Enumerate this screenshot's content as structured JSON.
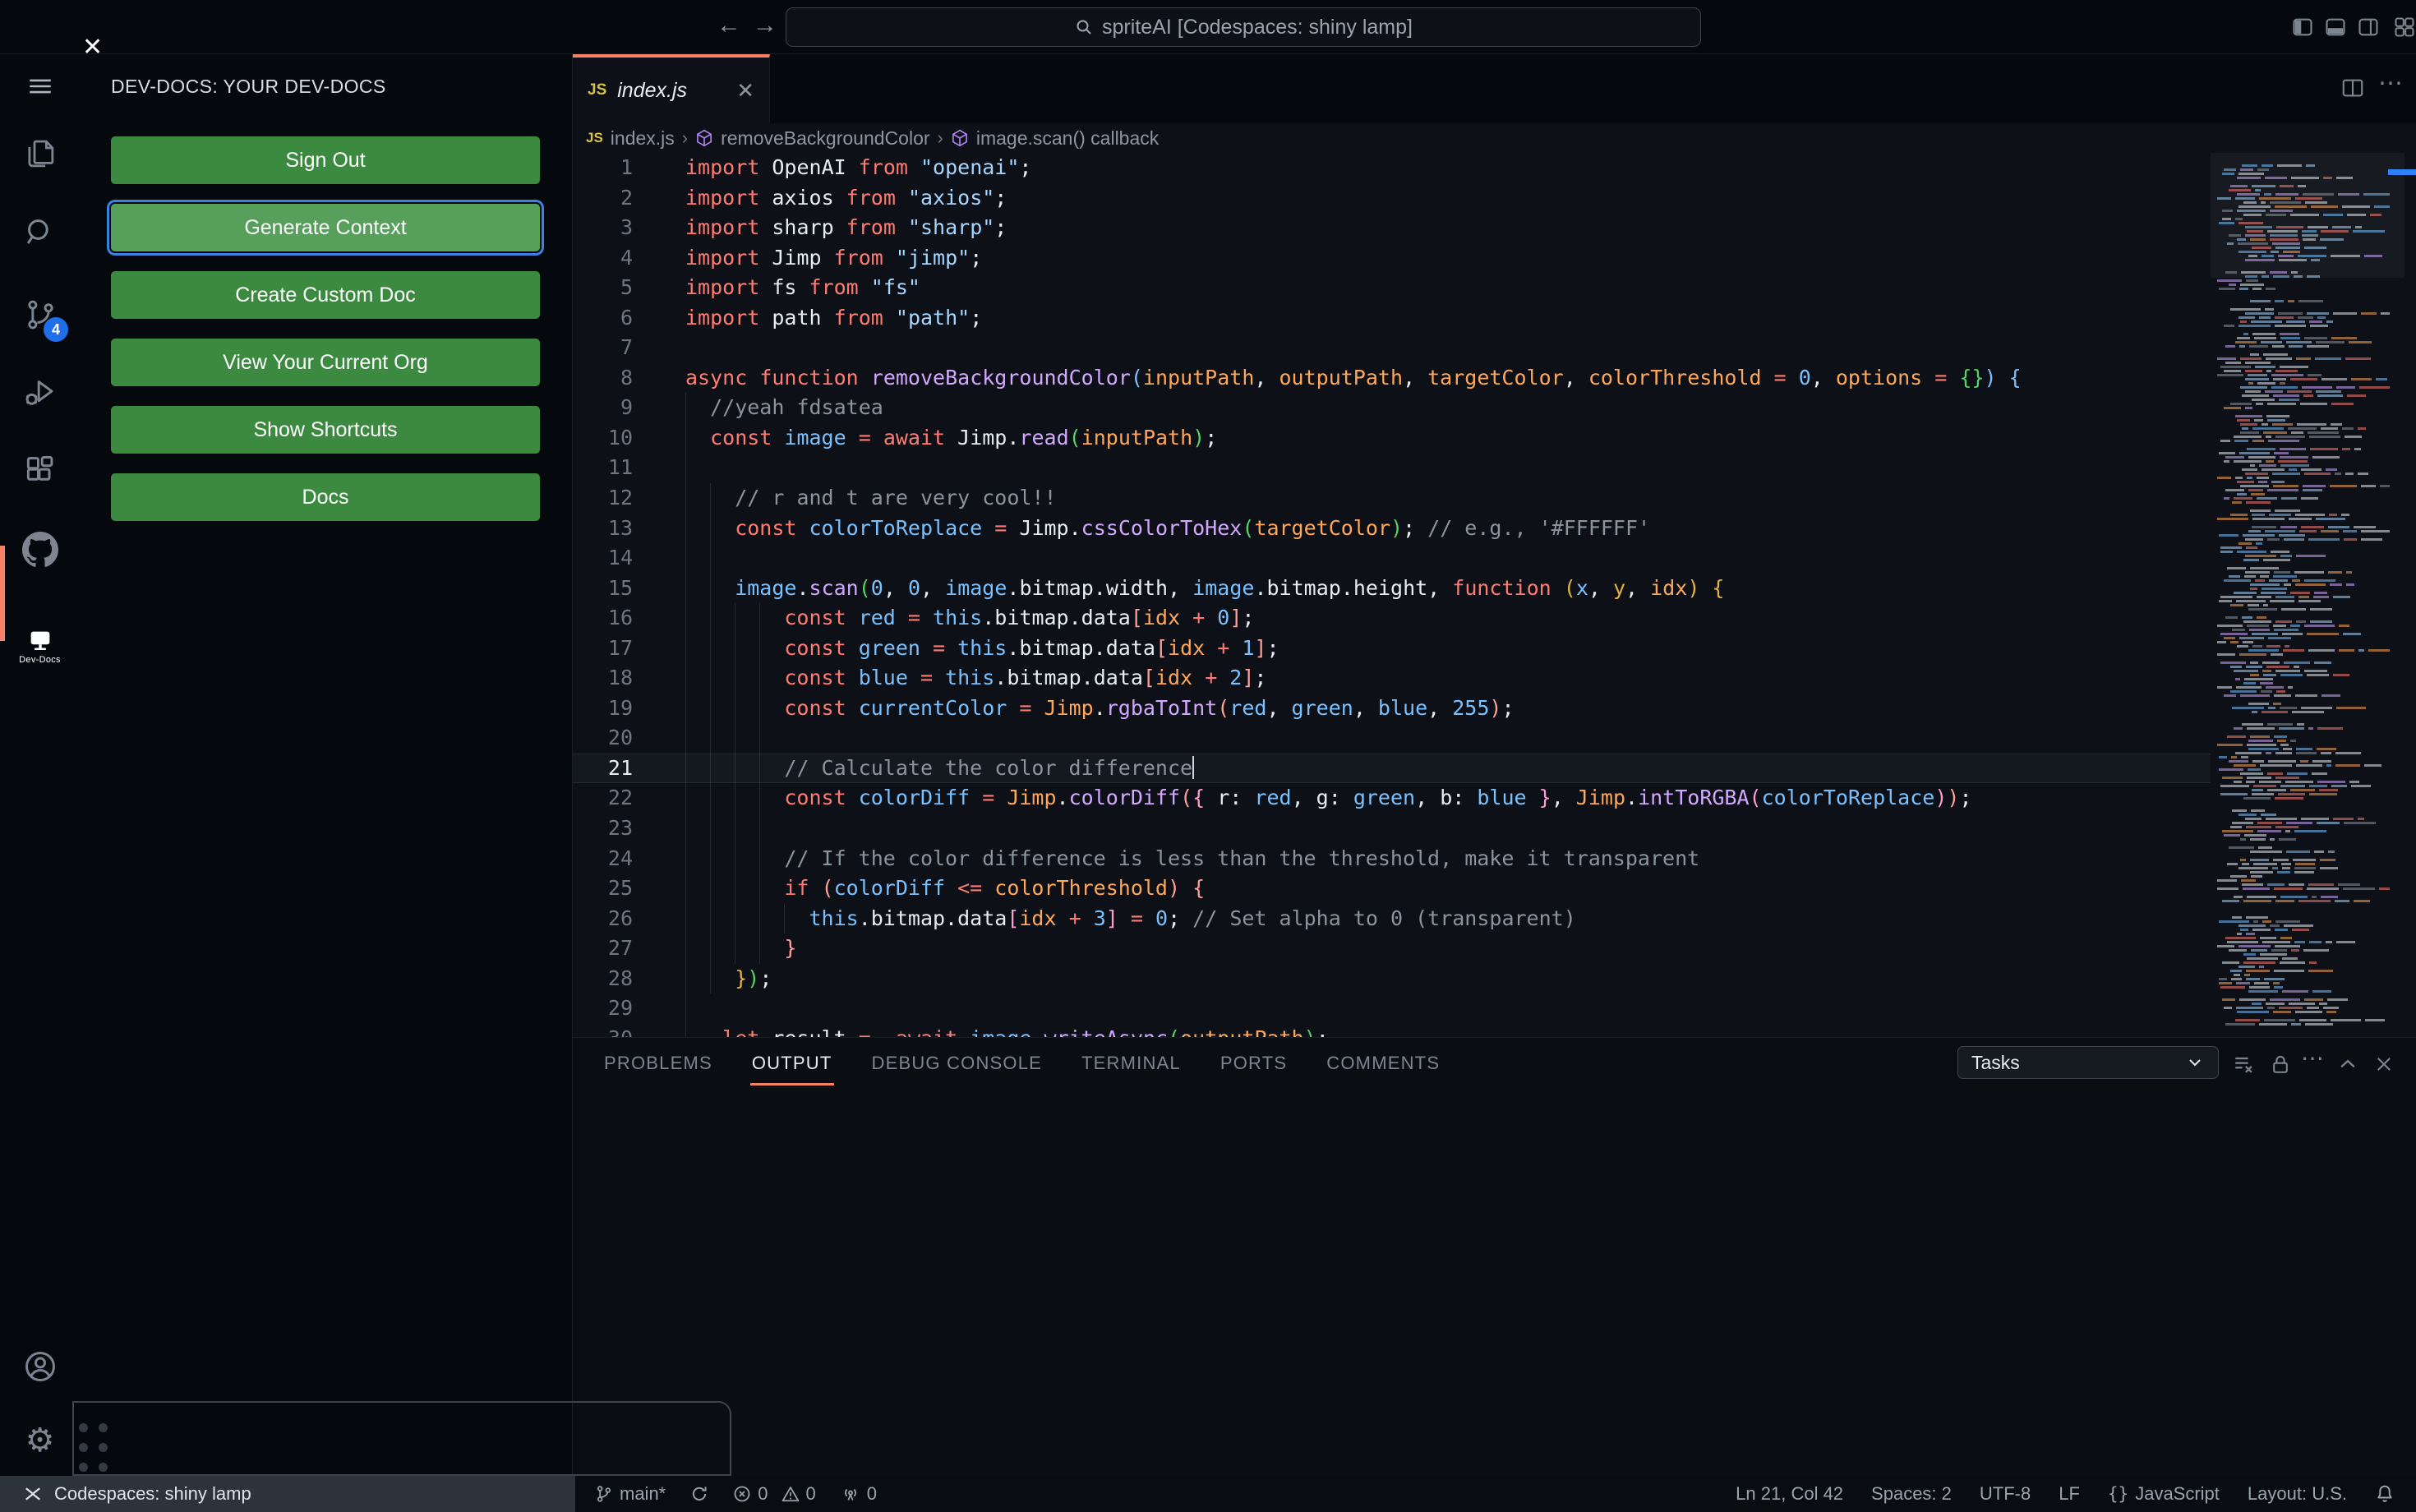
{
  "title_bar": {
    "search_text": "spriteAI [Codespaces: shiny lamp]"
  },
  "activity_bar": {
    "scm_badge": "4",
    "devdocs_label": "Dev-Docs"
  },
  "sidebar": {
    "header": "DEV-DOCS: YOUR DEV-DOCS",
    "buttons": [
      {
        "label": "Sign Out",
        "focused": false
      },
      {
        "label": "Generate Context",
        "focused": true
      },
      {
        "label": "Create Custom Doc",
        "focused": false
      },
      {
        "label": "View Your Current Org",
        "focused": false
      },
      {
        "label": "Show Shortcuts",
        "focused": false
      },
      {
        "label": "Docs",
        "focused": false
      }
    ]
  },
  "editor": {
    "tab": {
      "badge": "JS",
      "name": "index.js",
      "close": "✕"
    },
    "breadcrumb": [
      {
        "label": "index.js"
      },
      {
        "label": "removeBackgroundColor"
      },
      {
        "label": "image.scan() callback"
      }
    ],
    "cursor": {
      "line": 21,
      "col": 42
    },
    "lines": [
      {
        "n": 1,
        "ind": 0,
        "g": 0,
        "t": [
          [
            "import ",
            "k"
          ],
          [
            "OpenAI ",
            "w"
          ],
          [
            "from ",
            "k"
          ],
          [
            "\"openai\"",
            "s"
          ],
          [
            ";",
            "w"
          ]
        ]
      },
      {
        "n": 2,
        "ind": 0,
        "g": 0,
        "t": [
          [
            "import ",
            "k"
          ],
          [
            "axios ",
            "w"
          ],
          [
            "from ",
            "k"
          ],
          [
            "\"axios\"",
            "s"
          ],
          [
            ";",
            "w"
          ]
        ]
      },
      {
        "n": 3,
        "ind": 0,
        "g": 0,
        "t": [
          [
            "import ",
            "k"
          ],
          [
            "sharp ",
            "w"
          ],
          [
            "from ",
            "k"
          ],
          [
            "\"sharp\"",
            "s"
          ],
          [
            ";",
            "w"
          ]
        ]
      },
      {
        "n": 4,
        "ind": 0,
        "g": 0,
        "t": [
          [
            "import ",
            "k"
          ],
          [
            "Jimp ",
            "w"
          ],
          [
            "from ",
            "k"
          ],
          [
            "\"jimp\"",
            "s"
          ],
          [
            ";",
            "w"
          ]
        ]
      },
      {
        "n": 5,
        "ind": 0,
        "g": 0,
        "t": [
          [
            "import ",
            "k"
          ],
          [
            "fs ",
            "w"
          ],
          [
            "from ",
            "k"
          ],
          [
            "\"fs\"",
            "s"
          ]
        ]
      },
      {
        "n": 6,
        "ind": 0,
        "g": 0,
        "t": [
          [
            "import ",
            "k"
          ],
          [
            "path ",
            "w"
          ],
          [
            "from ",
            "k"
          ],
          [
            "\"path\"",
            "s"
          ],
          [
            ";",
            "w"
          ]
        ]
      },
      {
        "n": 7,
        "ind": 0,
        "g": 0,
        "t": []
      },
      {
        "n": 8,
        "ind": 0,
        "g": 0,
        "t": [
          [
            "async ",
            "k"
          ],
          [
            "function ",
            "k"
          ],
          [
            "removeBackgroundColor",
            "f"
          ],
          [
            "(",
            "b1"
          ],
          [
            "inputPath",
            "p"
          ],
          [
            ", ",
            "w"
          ],
          [
            "outputPath",
            "p"
          ],
          [
            ", ",
            "w"
          ],
          [
            "targetColor",
            "p"
          ],
          [
            ", ",
            "w"
          ],
          [
            "colorThreshold ",
            "p"
          ],
          [
            "= ",
            "k"
          ],
          [
            "0",
            "v"
          ],
          [
            ", ",
            "w"
          ],
          [
            "options ",
            "p"
          ],
          [
            "= ",
            "k"
          ],
          [
            "{}",
            "b2"
          ],
          [
            ") ",
            "b1"
          ],
          [
            "{",
            "b1"
          ]
        ]
      },
      {
        "n": 9,
        "ind": 2,
        "g": 1,
        "t": [
          [
            "//yeah fdsatea",
            "c"
          ]
        ]
      },
      {
        "n": 10,
        "ind": 2,
        "g": 1,
        "t": [
          [
            "const ",
            "k"
          ],
          [
            "image ",
            "v"
          ],
          [
            "= ",
            "k"
          ],
          [
            "await ",
            "k"
          ],
          [
            "Jimp",
            "w"
          ],
          [
            ".",
            "w"
          ],
          [
            "read",
            "f"
          ],
          [
            "(",
            "b2"
          ],
          [
            "inputPath",
            "p"
          ],
          [
            ")",
            "b2"
          ],
          [
            ";",
            "w"
          ]
        ]
      },
      {
        "n": 11,
        "ind": 2,
        "g": 1,
        "t": []
      },
      {
        "n": 12,
        "ind": 4,
        "g": 2,
        "t": [
          [
            "// r and t are very cool!!",
            "c"
          ]
        ]
      },
      {
        "n": 13,
        "ind": 4,
        "g": 2,
        "t": [
          [
            "const ",
            "k"
          ],
          [
            "colorToReplace ",
            "v"
          ],
          [
            "= ",
            "k"
          ],
          [
            "Jimp",
            "w"
          ],
          [
            ".",
            "w"
          ],
          [
            "cssColorToHex",
            "f"
          ],
          [
            "(",
            "b2"
          ],
          [
            "targetColor",
            "p"
          ],
          [
            ")",
            "b2"
          ],
          [
            "; ",
            "w"
          ],
          [
            "// e.g., '#FFFFFF'",
            "c"
          ]
        ]
      },
      {
        "n": 14,
        "ind": 4,
        "g": 2,
        "t": []
      },
      {
        "n": 15,
        "ind": 4,
        "g": 2,
        "t": [
          [
            "image",
            "v"
          ],
          [
            ".",
            "w"
          ],
          [
            "scan",
            "f"
          ],
          [
            "(",
            "b2"
          ],
          [
            "0",
            "v"
          ],
          [
            ", ",
            "w"
          ],
          [
            "0",
            "v"
          ],
          [
            ", ",
            "w"
          ],
          [
            "image",
            "v"
          ],
          [
            ".bitmap.width",
            "w"
          ],
          [
            ", ",
            "w"
          ],
          [
            "image",
            "v"
          ],
          [
            ".bitmap.height",
            "w"
          ],
          [
            ", ",
            "w"
          ],
          [
            "function ",
            "k"
          ],
          [
            "(",
            "b3"
          ],
          [
            "x",
            "v"
          ],
          [
            ", ",
            "w"
          ],
          [
            "y",
            "y"
          ],
          [
            ", ",
            "w"
          ],
          [
            "idx",
            "p"
          ],
          [
            ") ",
            "b3"
          ],
          [
            "{",
            "b3"
          ]
        ]
      },
      {
        "n": 16,
        "ind": 8,
        "g": 4,
        "t": [
          [
            "const ",
            "k"
          ],
          [
            "red ",
            "v"
          ],
          [
            "= ",
            "k"
          ],
          [
            "this",
            "v"
          ],
          [
            ".bitmap.data",
            "w"
          ],
          [
            "[",
            "b4"
          ],
          [
            "idx ",
            "p"
          ],
          [
            "+ ",
            "k"
          ],
          [
            "0",
            "v"
          ],
          [
            "]",
            "b4"
          ],
          [
            ";",
            "w"
          ]
        ]
      },
      {
        "n": 17,
        "ind": 8,
        "g": 4,
        "t": [
          [
            "const ",
            "k"
          ],
          [
            "green ",
            "v"
          ],
          [
            "= ",
            "k"
          ],
          [
            "this",
            "v"
          ],
          [
            ".bitmap.data",
            "w"
          ],
          [
            "[",
            "b4"
          ],
          [
            "idx ",
            "p"
          ],
          [
            "+ ",
            "k"
          ],
          [
            "1",
            "v"
          ],
          [
            "]",
            "b4"
          ],
          [
            ";",
            "w"
          ]
        ]
      },
      {
        "n": 18,
        "ind": 8,
        "g": 4,
        "t": [
          [
            "const ",
            "k"
          ],
          [
            "blue ",
            "v"
          ],
          [
            "= ",
            "k"
          ],
          [
            "this",
            "v"
          ],
          [
            ".bitmap.data",
            "w"
          ],
          [
            "[",
            "b4"
          ],
          [
            "idx ",
            "p"
          ],
          [
            "+ ",
            "k"
          ],
          [
            "2",
            "v"
          ],
          [
            "]",
            "b4"
          ],
          [
            ";",
            "w"
          ]
        ]
      },
      {
        "n": 19,
        "ind": 8,
        "g": 4,
        "t": [
          [
            "const ",
            "k"
          ],
          [
            "currentColor ",
            "v"
          ],
          [
            "= ",
            "k"
          ],
          [
            "Jimp",
            "p"
          ],
          [
            ".",
            "w"
          ],
          [
            "rgbaToInt",
            "f"
          ],
          [
            "(",
            "b4"
          ],
          [
            "red",
            "v"
          ],
          [
            ", ",
            "w"
          ],
          [
            "green",
            "v"
          ],
          [
            ", ",
            "w"
          ],
          [
            "blue",
            "v"
          ],
          [
            ", ",
            "w"
          ],
          [
            "255",
            "v"
          ],
          [
            ")",
            "b4"
          ],
          [
            ";",
            "w"
          ]
        ]
      },
      {
        "n": 20,
        "ind": 8,
        "g": 4,
        "t": []
      },
      {
        "n": 21,
        "ind": 8,
        "g": 4,
        "cur": true,
        "t": [
          [
            "// Calculate the color difference",
            "c"
          ]
        ]
      },
      {
        "n": 22,
        "ind": 8,
        "g": 4,
        "t": [
          [
            "const ",
            "k"
          ],
          [
            "colorDiff ",
            "v"
          ],
          [
            "= ",
            "k"
          ],
          [
            "Jimp",
            "p"
          ],
          [
            ".",
            "w"
          ],
          [
            "colorDiff",
            "f"
          ],
          [
            "(",
            "b4"
          ],
          [
            "{",
            "b5"
          ],
          [
            " r: ",
            "w"
          ],
          [
            "red",
            "v"
          ],
          [
            ", g: ",
            "w"
          ],
          [
            "green",
            "v"
          ],
          [
            ", b: ",
            "w"
          ],
          [
            "blue ",
            "v"
          ],
          [
            "}",
            "b5"
          ],
          [
            ", ",
            "w"
          ],
          [
            "Jimp",
            "p"
          ],
          [
            ".",
            "w"
          ],
          [
            "intToRGBA",
            "f"
          ],
          [
            "(",
            "b5"
          ],
          [
            "colorToReplace",
            "v"
          ],
          [
            ")",
            "b5"
          ],
          [
            ")",
            "b4"
          ],
          [
            ";",
            "w"
          ]
        ]
      },
      {
        "n": 23,
        "ind": 8,
        "g": 4,
        "t": []
      },
      {
        "n": 24,
        "ind": 8,
        "g": 4,
        "t": [
          [
            "// If the color difference is less than the threshold, make it transparent",
            "c"
          ]
        ]
      },
      {
        "n": 25,
        "ind": 8,
        "g": 4,
        "t": [
          [
            "if ",
            "k"
          ],
          [
            "(",
            "b4"
          ],
          [
            "colorDiff ",
            "v"
          ],
          [
            "<= ",
            "k"
          ],
          [
            "colorThreshold",
            "p"
          ],
          [
            ") ",
            "b4"
          ],
          [
            "{",
            "b4"
          ]
        ]
      },
      {
        "n": 26,
        "ind": 10,
        "g": 5,
        "t": [
          [
            "this",
            "v"
          ],
          [
            ".bitmap.data",
            "w"
          ],
          [
            "[",
            "b5"
          ],
          [
            "idx ",
            "p"
          ],
          [
            "+ ",
            "k"
          ],
          [
            "3",
            "v"
          ],
          [
            "]",
            "b5"
          ],
          [
            " ",
            "w"
          ],
          [
            "= ",
            "k"
          ],
          [
            "0",
            "v"
          ],
          [
            "; ",
            "w"
          ],
          [
            "// Set alpha to 0 (transparent)",
            "c"
          ]
        ]
      },
      {
        "n": 27,
        "ind": 8,
        "g": 4,
        "t": [
          [
            "}",
            "b4"
          ]
        ]
      },
      {
        "n": 28,
        "ind": 4,
        "g": 2,
        "t": [
          [
            "}",
            "b3"
          ],
          [
            ")",
            "b2"
          ],
          [
            ";",
            "w"
          ]
        ]
      },
      {
        "n": 29,
        "ind": 2,
        "g": 1,
        "t": []
      },
      {
        "n": 30,
        "ind": 3,
        "g": 1,
        "t": [
          [
            "let ",
            "k"
          ],
          [
            "result ",
            "w"
          ],
          [
            "=  ",
            "k"
          ],
          [
            "await ",
            "k"
          ],
          [
            "image",
            "v"
          ],
          [
            ".",
            "w"
          ],
          [
            "writeAsync",
            "f"
          ],
          [
            "(",
            "b2"
          ],
          [
            "outputPath",
            "p"
          ],
          [
            ")",
            "b2"
          ],
          [
            ";",
            "w"
          ]
        ]
      }
    ]
  },
  "panel": {
    "tabs": [
      {
        "label": "PROBLEMS",
        "active": false
      },
      {
        "label": "OUTPUT",
        "active": true
      },
      {
        "label": "DEBUG CONSOLE",
        "active": false
      },
      {
        "label": "TERMINAL",
        "active": false
      },
      {
        "label": "PORTS",
        "active": false
      },
      {
        "label": "COMMENTS",
        "active": false
      }
    ],
    "tasks_dropdown": "Tasks"
  },
  "status_bar": {
    "remote_label": "Codespaces: shiny lamp",
    "branch": "main*",
    "errors": "0",
    "warnings": "0",
    "ports": "0",
    "ln_col": "Ln 21, Col 42",
    "spaces": "Spaces: 2",
    "encoding": "UTF-8",
    "eol": "LF",
    "language": "JavaScript",
    "layout": "Layout: U.S."
  },
  "overlay_box": {
    "close": "✕"
  },
  "icons": {
    "gear": "⚙",
    "ellipsis": "⋯",
    "braces": "{}",
    "back": "←",
    "forward": "→",
    "chevron_down": "⌄"
  },
  "colors": {
    "k": "#ff7b72",
    "f": "#d2a8ff",
    "p": "#ffa657",
    "s": "#a5d6ff",
    "v": "#79c0ff",
    "c": "#8b949e",
    "w": "#e6edf3",
    "y": "#e3b341",
    "b1": "#79c0ff",
    "b2": "#56d364",
    "b3": "#e3b341",
    "b4": "#ffa198",
    "b5": "#ff9bce",
    "accent": "#f78166",
    "badge_blue": "#1f6feb",
    "button_green": "#3c8a40",
    "focus_ring": "#3b82e0"
  }
}
